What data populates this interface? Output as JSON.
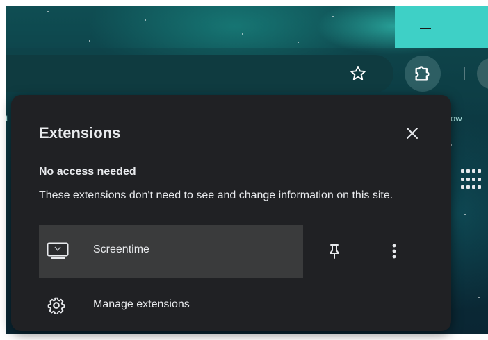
{
  "window": {
    "minimize_icon": "minimize-icon",
    "restore_icon": "restore-icon"
  },
  "toolbar": {
    "bookmark_star_icon": "star-outline-icon",
    "extensions_icon": "puzzle-piece-icon",
    "bookmarks_bar_right_fragment": "ow",
    "bookmarks_bar_left_fragment": "t",
    "apps_icon": "apps-grid-icon"
  },
  "popup": {
    "title": "Extensions",
    "close_icon": "close-icon",
    "section": {
      "heading": "No access needed",
      "description": "These extensions don't need to see and change information on this site."
    },
    "extensions": [
      {
        "name": "Screentime",
        "icon": "monitor-icon",
        "pin_icon": "pin-icon",
        "more_icon": "more-vert-icon"
      }
    ],
    "manage": {
      "label": "Manage extensions",
      "icon": "gear-icon"
    }
  },
  "colors": {
    "popup_bg": "#202124",
    "row_hover": "#3a3b3c",
    "text": "#e8eaed",
    "accent_teal": "#3ed0c6"
  }
}
